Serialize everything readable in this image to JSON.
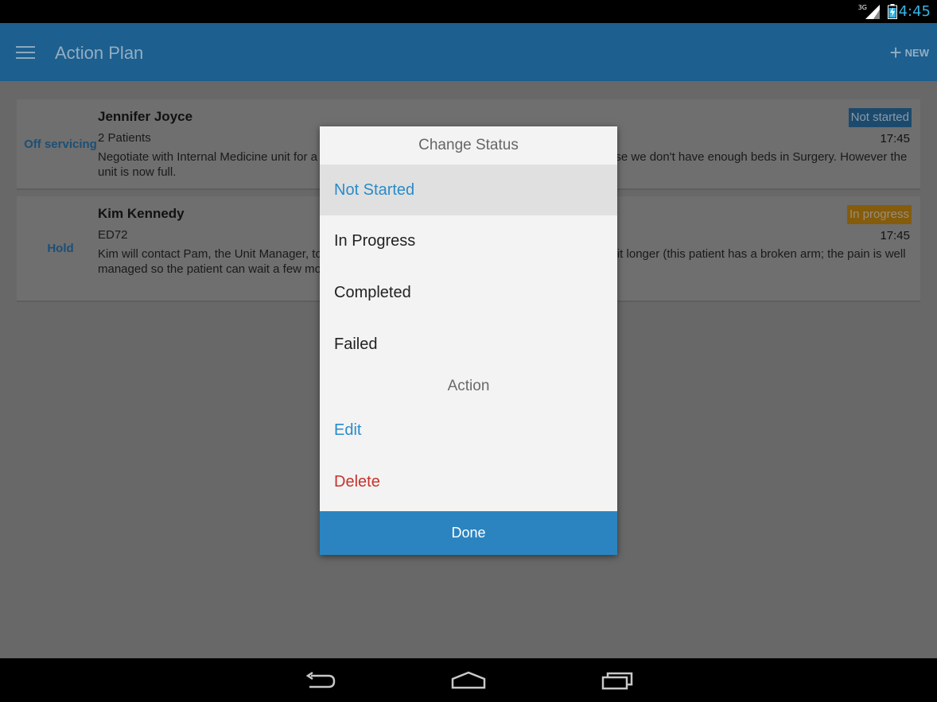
{
  "status_bar": {
    "network": "3G",
    "time": "4:45"
  },
  "app_bar": {
    "title": "Action Plan",
    "new_label": "NEW"
  },
  "cards": [
    {
      "category": "Off servicing",
      "name": "Jennifer Joyce",
      "subtitle": "2 Patients",
      "description": "Negotiate with Internal Medicine unit for [obscured] pes temporarily to the Medicine unit because we don't have enough beds in Surgery. Ho[obscured] ull.",
      "status": "Not started",
      "time": "17:45"
    },
    {
      "category": "Hold",
      "name": "Kim Kennedy",
      "subtitle": "ED72",
      "description": "Kim will contact Pam, the Unit Manage[obscured] he patient to be sent to Surgery a bit longer (this patient has a broken arm; the pain is w[obscured] e patient can wait a few more hours before being sent by ED to Surgery)",
      "status": "In progress",
      "time": "17:45"
    }
  ],
  "dialog": {
    "title": "Change Status",
    "status_options": [
      "Not Started",
      "In Progress",
      "Completed",
      "Failed"
    ],
    "selected": "Not Started",
    "section_label": "Action",
    "edit_label": "Edit",
    "delete_label": "Delete",
    "done_label": "Done"
  },
  "colors": {
    "app_bar": "#2b84c0",
    "accent_blue": "#2a8bc9",
    "delete_red": "#c5332b",
    "badge_not_started": "#2c6fa3",
    "badge_in_progress": "#d08e14"
  },
  "nav_icons": [
    "back-icon",
    "home-icon",
    "recents-icon"
  ]
}
